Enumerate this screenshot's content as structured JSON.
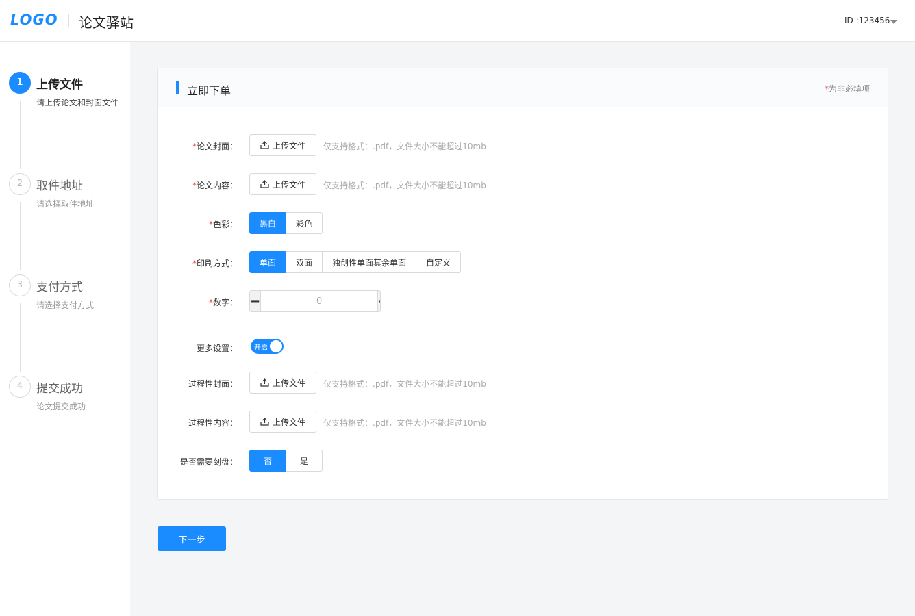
{
  "header": {
    "logo": "LOGO",
    "title": "论文驿站",
    "user_id": "ID :123456"
  },
  "steps": [
    {
      "num": "1",
      "title": "上传文件",
      "desc": "请上传论文和封面文件",
      "active": true
    },
    {
      "num": "2",
      "title": "取件地址",
      "desc": "请选择取件地址",
      "active": false
    },
    {
      "num": "3",
      "title": "支付方式",
      "desc": "请选择支付方式",
      "active": false
    },
    {
      "num": "4",
      "title": "提交成功",
      "desc": "论文提交成功",
      "active": false
    }
  ],
  "card": {
    "title": "立即下单",
    "note_star": "*",
    "note": "为非必填项"
  },
  "form": {
    "required_mark": "*",
    "cover": {
      "label": "论文封面：",
      "button": "上传文件",
      "hint": "仅支持格式：.pdf，文件大小不能超过10mb"
    },
    "content": {
      "label": "论文内容：",
      "button": "上传文件",
      "hint": "仅支持格式：.pdf，文件大小不能超过10mb"
    },
    "color": {
      "label": "色彩：",
      "options": [
        "黑白",
        "彩色"
      ],
      "selected": "黑白"
    },
    "print": {
      "label": "印刷方式：",
      "options": [
        "单面",
        "双面",
        "独创性单面其余单面",
        "自定义"
      ],
      "selected": "单面"
    },
    "number": {
      "label": "数字：",
      "value": "0",
      "minus": "−",
      "plus": "+"
    },
    "more": {
      "label": "更多设置：",
      "switch_text": "开启",
      "on": true
    },
    "process_cover": {
      "label": "过程性封面：",
      "button": "上传文件",
      "hint": "仅支持格式：.pdf，文件大小不能超过10mb"
    },
    "process_content": {
      "label": "过程性内容：",
      "button": "上传文件",
      "hint": "仅支持格式：.pdf，文件大小不能超过10mb"
    },
    "burn": {
      "label": "是否需要刻盘：",
      "options": [
        "否",
        "是"
      ],
      "selected": "否"
    }
  },
  "next_button": "下一步",
  "colors": {
    "primary": "#1a8cff",
    "required": "#e84848"
  }
}
